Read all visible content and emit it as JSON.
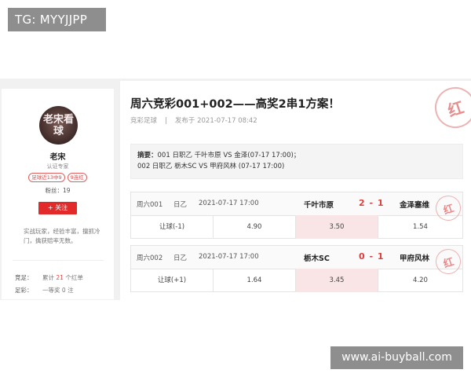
{
  "watermark_top": "TG: MYYJJPP",
  "watermark_bottom": "www.ai-buyball.com",
  "author": {
    "avatar_text": "老宋看球",
    "name": "老宋",
    "role": "认证专家",
    "badges": [
      "足球近13中9",
      "9连红"
    ],
    "fans": "粉丝：19",
    "follow_label": "+ 关注",
    "bio": "实战玩家，经验丰富，擅抓冷门，擒获赔率无数。",
    "stats": [
      {
        "key": "竞足：",
        "prefix": "累计",
        "num": "21",
        "suffix": "个红单"
      },
      {
        "key": "足彩：",
        "prefix": "一等奖",
        "num": "0",
        "suffix": "注"
      }
    ]
  },
  "article": {
    "title": "周六竞彩001+002——高奖2串1方案！",
    "category": "竞彩足球",
    "separator": "|",
    "published": "发布于 2021-07-17 08:42",
    "seal": "红",
    "summary_label": "摘要：",
    "summary_line1": "001 日职乙 千叶市原 VS 金泽(07-17 17:00)；",
    "summary_line2": "002 日职乙 栃木SC VS 甲府风林  (07-17 17:00)"
  },
  "matches": [
    {
      "code": "周六001",
      "league": "日乙",
      "time": "2021-07-17 17:00",
      "home": "千叶市原",
      "score": "2 - 1",
      "away": "金泽塞维",
      "seal": "红",
      "handicap": "让球(-1)",
      "odds": [
        "4.90",
        "3.50",
        "1.54"
      ],
      "selected": 1
    },
    {
      "code": "周六002",
      "league": "日乙",
      "time": "2021-07-17 17:00",
      "home": "栃木SC",
      "score": "0 - 1",
      "away": "甲府风林",
      "seal": "红",
      "handicap": "让球(+1)",
      "odds": [
        "1.64",
        "3.45",
        "4.20"
      ],
      "selected": 1
    }
  ],
  "colors": {
    "accent_red": "#e22a2a",
    "selected_cell": "#f9e5e5",
    "watermark_bg": "#8e8e8e"
  }
}
